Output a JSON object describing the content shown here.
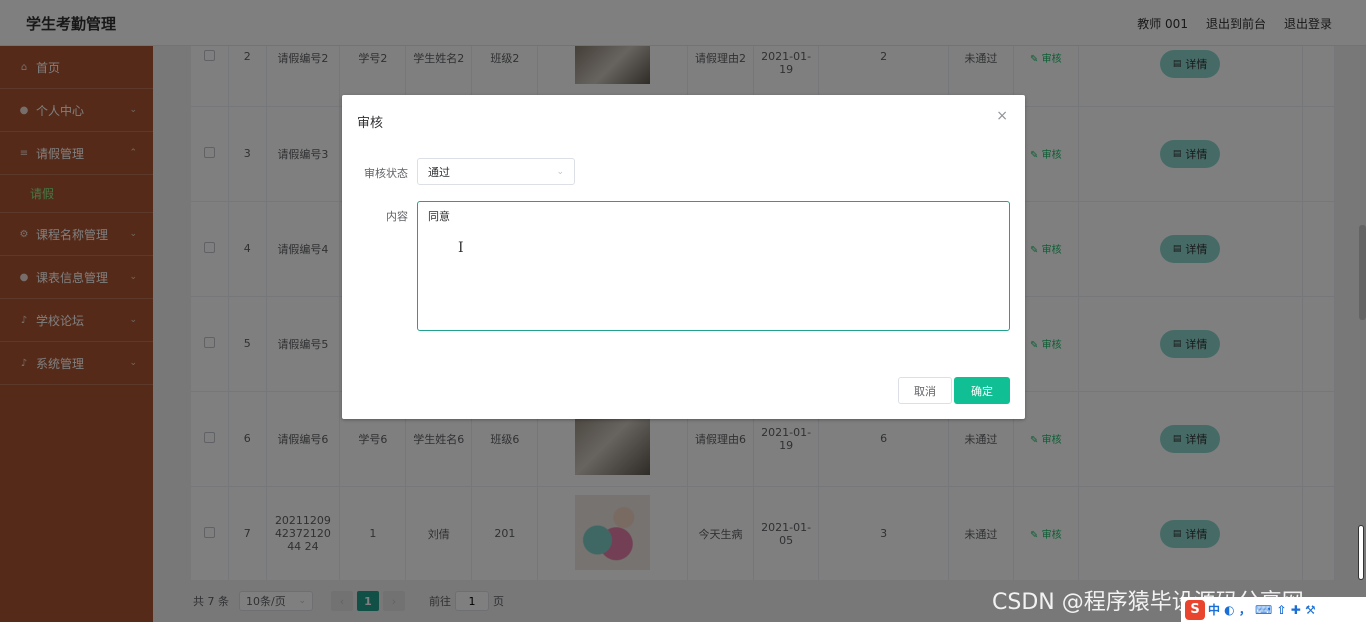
{
  "header": {
    "app_title": "学生考勤管理",
    "user": "教师 001",
    "to_front": "退出到前台",
    "logout": "退出登录"
  },
  "sidebar": {
    "items": [
      {
        "label": "首页",
        "icon": "home-icon"
      },
      {
        "label": "个人中心",
        "icon": "user-icon"
      },
      {
        "label": "请假管理",
        "icon": "menu-icon"
      },
      {
        "label": "课程名称管理",
        "icon": "gear-icon"
      },
      {
        "label": "课表信息管理",
        "icon": "user-icon"
      },
      {
        "label": "学校论坛",
        "icon": "mic-icon"
      },
      {
        "label": "系统管理",
        "icon": "mic-icon"
      }
    ],
    "sub_item": "请假"
  },
  "table": {
    "rows": [
      {
        "index": "2",
        "leave_no": "请假编号2",
        "student_no": "学号2",
        "student_name": "学生姓名2",
        "class": "班级2",
        "reason": "请假理由2",
        "date": "2021-01-19",
        "days": "2",
        "status": "未通过",
        "audit": "审核",
        "detail": "详情"
      },
      {
        "index": "3",
        "leave_no": "请假编号3",
        "audit": "审核",
        "detail": "详情"
      },
      {
        "index": "4",
        "leave_no": "请假编号4",
        "audit": "审核",
        "detail": "详情"
      },
      {
        "index": "5",
        "leave_no": "请假编号5",
        "audit": "审核",
        "detail": "详情"
      },
      {
        "index": "6",
        "leave_no": "请假编号6",
        "student_no": "学号6",
        "student_name": "学生姓名6",
        "class": "班级6",
        "reason": "请假理由6",
        "date": "2021-01-19",
        "days": "6",
        "status": "未通过",
        "audit": "审核",
        "detail": "详情"
      },
      {
        "index": "7",
        "leave_no": "202112094237212044 24",
        "student_no": "1",
        "student_name": "刘倩",
        "class": "201",
        "reason": "今天生病",
        "date": "2021-01-05",
        "days": "3",
        "status": "未通过",
        "audit": "审核",
        "detail": "详情"
      }
    ]
  },
  "pager": {
    "total": "共 7 条",
    "page_size": "10条/页",
    "current_page": "1",
    "goto_label": "前往",
    "goto_value": "1",
    "page_suffix": "页"
  },
  "dialog": {
    "title": "审核",
    "status_label": "审核状态",
    "status_value": "通过",
    "content_label": "内容",
    "content_value": "同意",
    "cancel": "取消",
    "confirm": "确定"
  },
  "watermark": "CSDN @程序猿毕设源码分享网",
  "ime": {
    "logo": "S",
    "chars": "中 ◐ ， ⌨ ⇧ ✚ ⚒"
  }
}
